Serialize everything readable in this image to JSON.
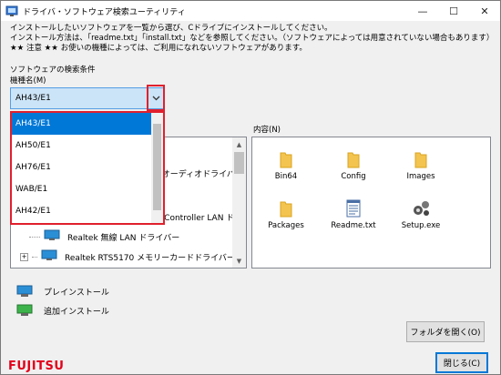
{
  "window": {
    "title": "ドライバ・ソフトウェア検索ユーティリティ",
    "minimize_glyph": "—",
    "maximize_glyph": "☐",
    "close_glyph": "✕"
  },
  "instructions": [
    "インストールしたいソフトウェアを一覧から選び、Cドライブにインストールしてください。",
    "インストール方法は、「readme.txt」「install.txt」などを参照してください。（ソフトウェアによっては用意されていない場合もあります）",
    "★★ 注意 ★★ お使いの機種によっては、ご利用になれないソフトウェアがあります。"
  ],
  "search": {
    "conditions_label": "ソフトウェアの検索条件",
    "model_label": "機種名(M)",
    "model_value": "AH43/E1",
    "options": [
      "AH43/E1",
      "AH50/E1",
      "AH76/E1",
      "WAB/E1",
      "AH42/E1"
    ],
    "selected_index": 0
  },
  "tree": {
    "rows": [
      {
        "text": "オーディオドライバー",
        "prefix": "b "
      },
      {
        "text": "y Controller LAN ドラ",
        "prefix": ""
      },
      {
        "text": "Realtek 無線 LAN ドライバー"
      },
      {
        "text": "Realtek RTS5170 メモリーカードドライバー"
      }
    ]
  },
  "contents": {
    "label": "内容(N)",
    "files": [
      {
        "name": "Bin64",
        "icon": "folder-icon"
      },
      {
        "name": "Config",
        "icon": "folder-icon"
      },
      {
        "name": "Images",
        "icon": "folder-icon"
      },
      {
        "name": "Packages",
        "icon": "folder-icon"
      },
      {
        "name": "Readme.txt",
        "icon": "text-file-icon"
      },
      {
        "name": "Setup.exe",
        "icon": "setup-icon"
      }
    ]
  },
  "legend": {
    "preinstall": "プレインストール",
    "additional": "追加インストール"
  },
  "buttons": {
    "open_folder": "フォルダを開く(O)",
    "close": "閉じる(C)"
  },
  "brand": {
    "logo_text": "FUJITSU",
    "color": "#e2001a"
  },
  "colors": {
    "highlight": "#0078d7",
    "annotation_red": "#e0202e",
    "folder": "#f3c44f"
  }
}
